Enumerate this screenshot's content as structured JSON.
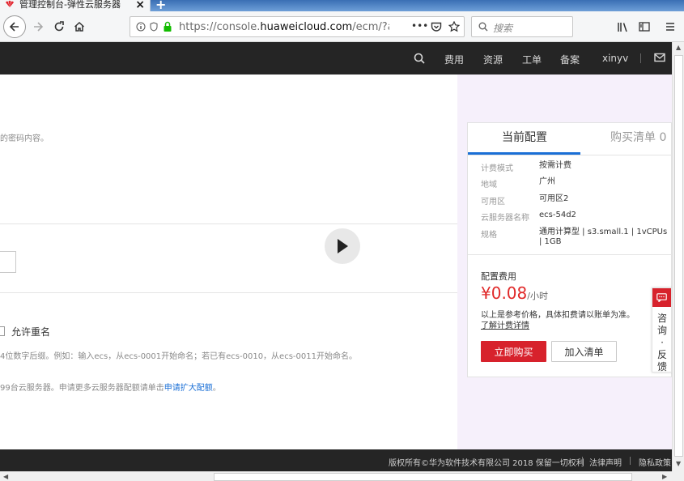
{
  "browser": {
    "tab_title": "管理控制台-弹性云服务器",
    "tab_close": "×",
    "new_tab": "+",
    "url_prefix": "https://console.",
    "url_domain": "huaweicloud.com",
    "url_suffix": "/ecm/?agenc",
    "url_more": "•••",
    "search_placeholder": "搜索"
  },
  "header": {
    "nav_items": [
      "费用",
      "资源",
      "工单",
      "备案"
    ],
    "username": "xinyv"
  },
  "main": {
    "password_hint_fragment": "的密码内容。",
    "allow_rename_label": "允许重名",
    "naming_hint_fragment": "4位数字后缀。例如：输入ecs，从ecs-0001开始命名；若已有ecs-0010，从ecs-0011开始命名。",
    "quota_hint_fragment": "99台云服务器。申请更多云服务器配额请单击",
    "quota_link": "申请扩大配额",
    "quota_hint_end": "。"
  },
  "card": {
    "tab_current": "当前配置",
    "tab_cart": "购买清单 0",
    "config": [
      {
        "label": "计费模式",
        "value": "按需计费"
      },
      {
        "label": "地域",
        "value": "广州"
      },
      {
        "label": "可用区",
        "value": "可用区2"
      },
      {
        "label": "云服务器名称",
        "value": "ecs-54d2"
      },
      {
        "label": "规格",
        "value": "通用计算型 | s3.small.1 | 1vCPUs | 1GB"
      }
    ],
    "fee_label": "配置费用",
    "price": "¥0.08",
    "price_unit": "/小时",
    "price_note": "以上是参考价格，具体扣费请以账单为准。",
    "price_link": "了解计费详情",
    "buy_button": "立即购买",
    "add_cart_button": "加入清单"
  },
  "feedback": {
    "text": "咨询·反馈"
  },
  "footer": {
    "copyright": "版权所有©华为软件技术有限公司 2018 保留一切权利",
    "legal": "法律声明",
    "privacy": "隐私政策"
  },
  "colors": {
    "brand_red": "#d7222c",
    "link_blue": "#1a6fd6",
    "header_bg": "#252525",
    "panel_bg": "#f6f0fb"
  }
}
